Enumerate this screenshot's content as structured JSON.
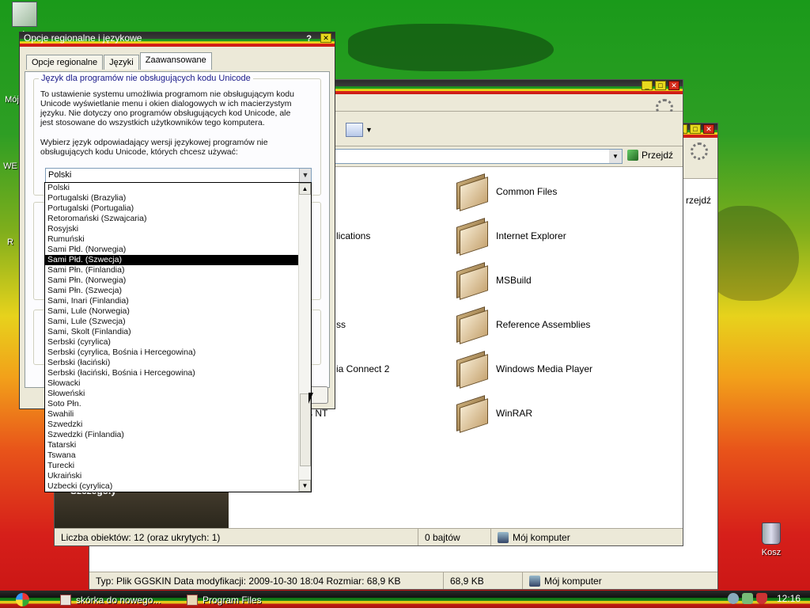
{
  "desktop": {
    "icons": [
      {
        "label": "do"
      },
      {
        "label": "Mój"
      },
      {
        "label": "WE"
      },
      {
        "label": "R"
      },
      {
        "label": "Kosz"
      }
    ]
  },
  "back_explorer": {
    "goto_label": "rzejdź",
    "status": {
      "info": "Typ: Plik GGSKIN Data modyfikacji: 2009-10-30 18:04 Rozmiar: 68,9 KB",
      "size": "68,9 KB",
      "location": "Mój komputer"
    }
  },
  "explorer": {
    "goto_label": "Przejdź",
    "side_panel": {
      "details_label": "Szczegóły"
    },
    "left_items": [
      "lications",
      "ss",
      "ia Connect 2",
      "s NT"
    ],
    "right_items": [
      "Common Files",
      "Internet Explorer",
      "MSBuild",
      "Reference Assemblies",
      "Windows Media Player",
      "WinRAR"
    ],
    "status": {
      "count": "Liczba obiektów: 12 (oraz ukrytych: 1)",
      "size": "0 bajtów",
      "location": "Mój komputer"
    }
  },
  "dialog": {
    "title": "Opcje regionalne i językowe",
    "help_glyph": "?",
    "close_glyph": "✕",
    "tabs": [
      {
        "label": "Opcje regionalne"
      },
      {
        "label": "Języki"
      },
      {
        "label": "Zaawansowane"
      }
    ],
    "group_title": "Język dla programów nie obsługujących kodu Unicode",
    "para1": "To ustawienie systemu umożliwia programom nie obsługującym kodu Unicode wyświetlanie menu i okien dialogowych w ich macierzystym języku. Nie dotyczy ono programów obsługujących kod Unicode, ale jest stosowane do wszystkich użytkowników tego komputera.",
    "para2": "Wybierz język odpowiadający wersji językowej programów nie obsługujących kodu Unicode, których chcesz używać:",
    "combo_value": "Polski",
    "dropdown_items": [
      "Polski",
      "Portugalski (Brazylia)",
      "Portugalski (Portugalia)",
      "Retoromański (Szwajcaria)",
      "Rosyjski",
      "Rumuński",
      "Sami Płd. (Norwegia)",
      "Sami Płd. (Szwecja)",
      "Sami Płn. (Finlandia)",
      "Sami Płn. (Norwegia)",
      "Sami Płn. (Szwecja)",
      "Sami, Inari (Finlandia)",
      "Sami, Lule (Norwegia)",
      "Sami, Lule (Szwecja)",
      "Sami, Skolt (Finlandia)",
      "Serbski (cyrylica)",
      "Serbski (cyrylica, Bośnia i Hercegowina)",
      "Serbski (łaciński)",
      "Serbski (łaciński, Bośnia i Hercegowina)",
      "Słowacki",
      "Słoweński",
      "Soto Płn.",
      "Swahili",
      "Szwedzki",
      "Szwedzki (Finlandia)",
      "Tatarski",
      "Tswana",
      "Turecki",
      "Ukraiński",
      "Uzbecki (cyrylica)"
    ],
    "selected_item": "Sami Płd. (Szwecja)"
  },
  "taskbar": {
    "tasks": [
      {
        "label": "skórka do nowego..."
      },
      {
        "label": "Program Files"
      }
    ],
    "clock": "12:16"
  },
  "colors": {
    "listbox_selection": "#000000",
    "dialog_face": "#ece9d8",
    "link_blue": "#1a1a8a"
  }
}
